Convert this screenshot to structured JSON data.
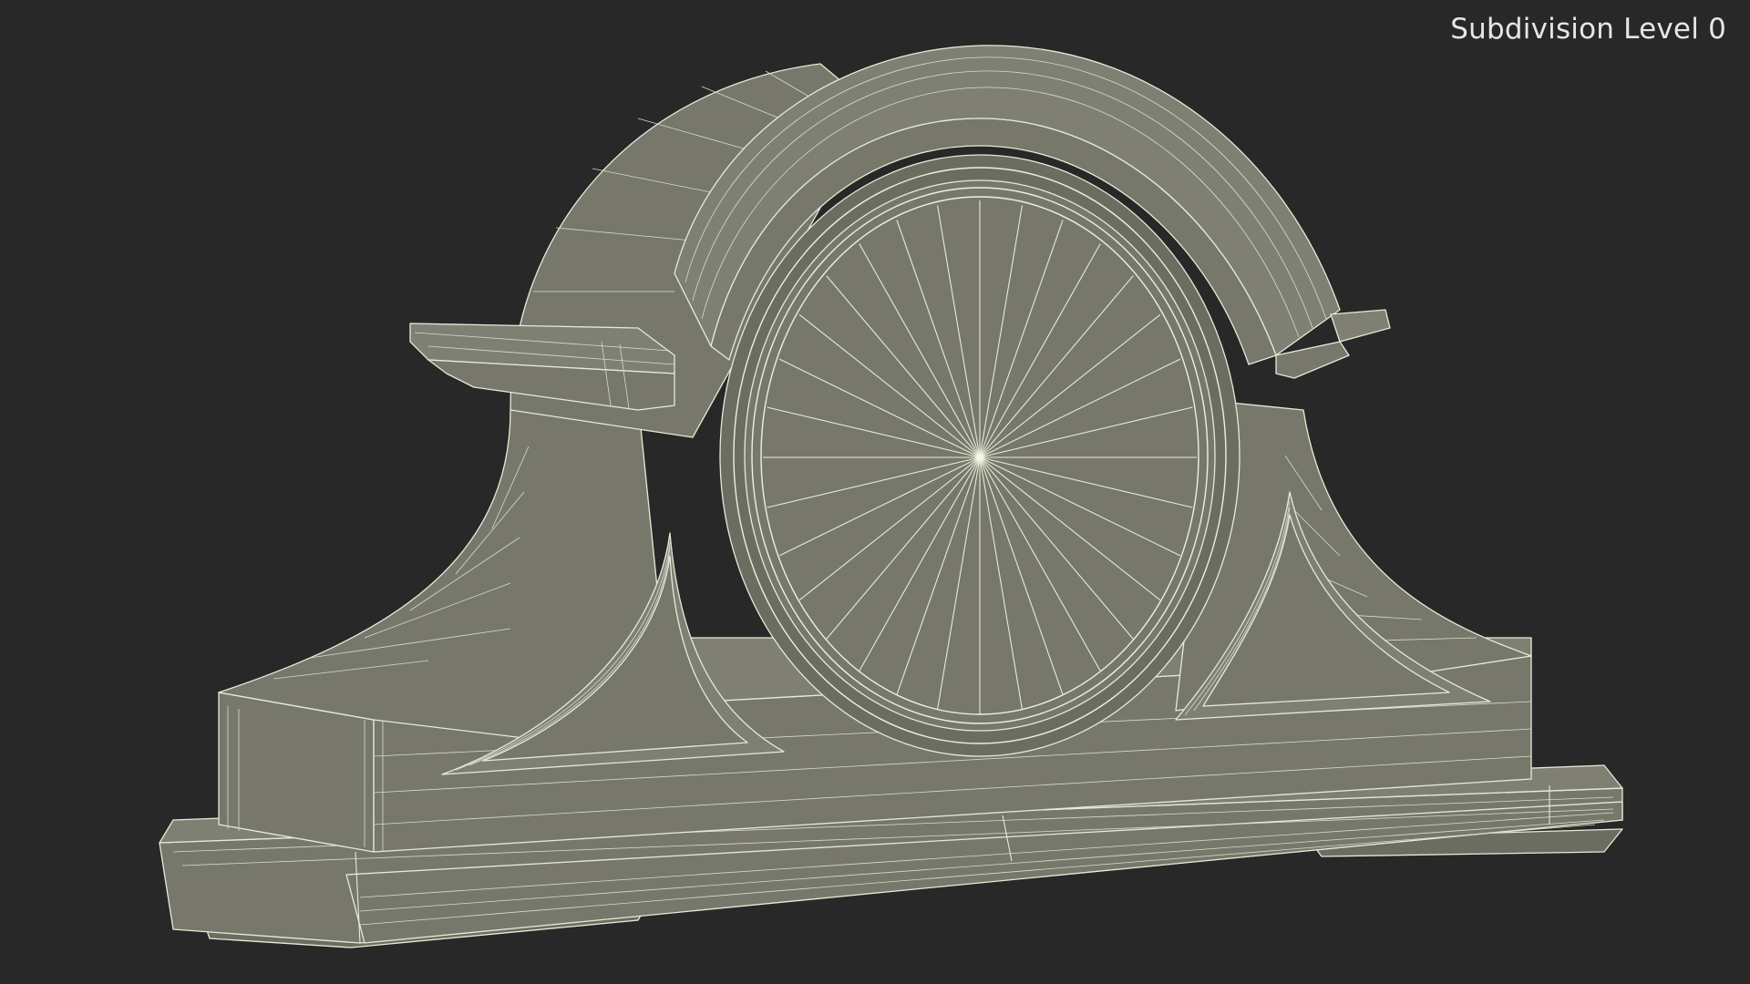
{
  "overlay": {
    "subdivision_label": "Subdivision Level 0"
  },
  "colors": {
    "background": "#282828",
    "mesh_fill": "#77786b",
    "wire": "#e8ead8",
    "label_text": "#e6e6e6"
  },
  "model": {
    "name": "mantel-clock-wireframe",
    "dial_spokes": 32,
    "arch_segments": 18
  }
}
